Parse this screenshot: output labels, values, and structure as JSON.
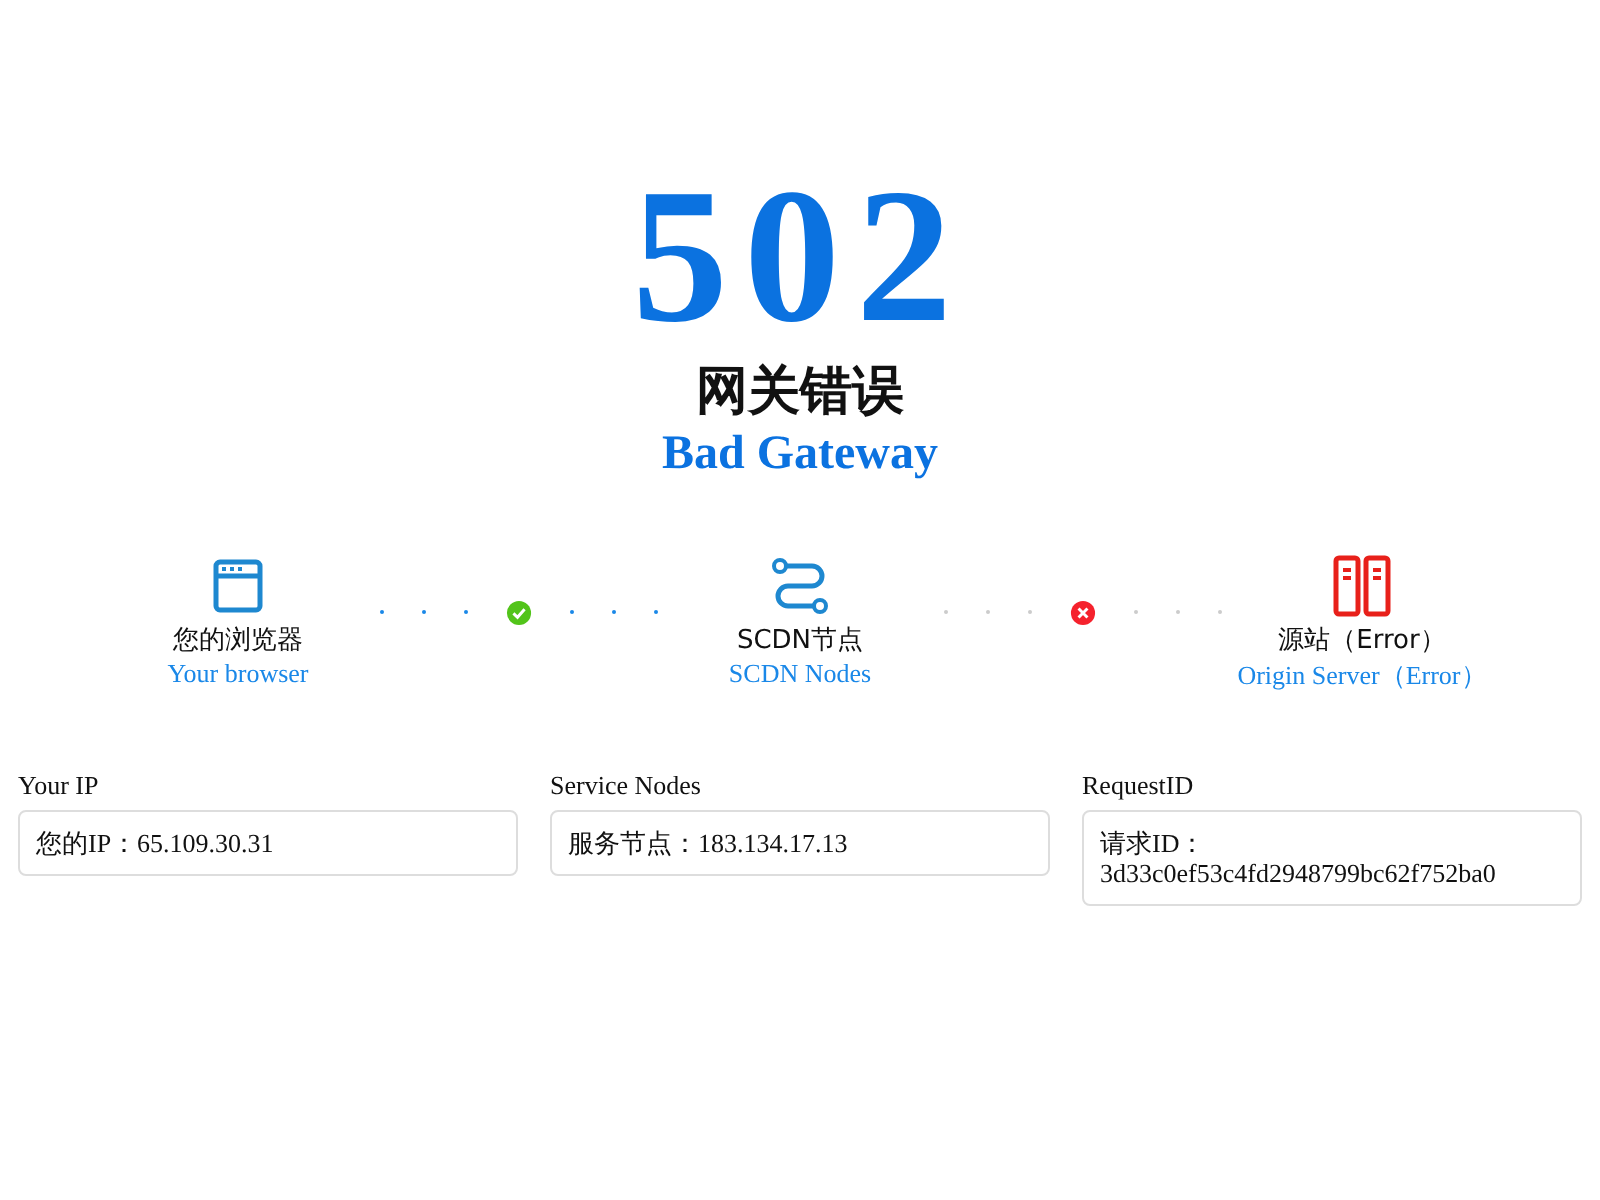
{
  "code": "502",
  "title": "网关错误",
  "subtitle": "Bad Gateway",
  "nodes": [
    {
      "kind": "browser",
      "label": "您的浏览器",
      "sublabel": "Your browser"
    },
    {
      "kind": "cdn",
      "label": "SCDN节点",
      "sublabel": "SCDN Nodes"
    },
    {
      "kind": "origin",
      "label": "源站（Error）",
      "sublabel": "Origin Server（Error）"
    }
  ],
  "links": [
    {
      "failed": false
    },
    {
      "failed": true
    }
  ],
  "info": [
    {
      "label": "Your IP",
      "value": "您的IP：65.109.30.31"
    },
    {
      "label": "Service Nodes",
      "value": "服务节点：183.134.17.13"
    },
    {
      "label": "RequestID",
      "value": "请求ID：\n3d33c0ef53c4fd2948799bc62f752ba0"
    }
  ]
}
